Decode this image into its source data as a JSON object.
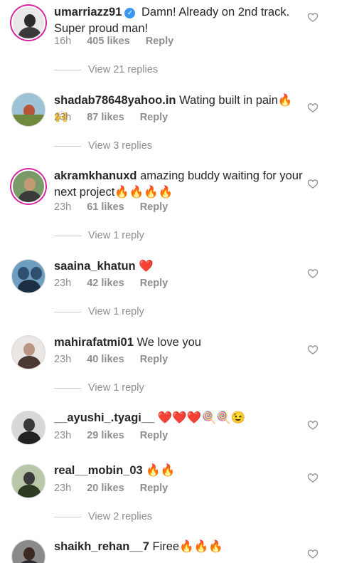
{
  "comments": [
    {
      "username": "umarriazz91",
      "verified": true,
      "text": "Damn! Already on 2nd track. Super proud man!",
      "time": "16h",
      "likes": "405 likes",
      "reply": "Reply",
      "view_replies": "View 21 replies",
      "avatar_colors": [
        "#e8e8e8",
        "#2b2b2b",
        "#3a3a3a"
      ]
    },
    {
      "username": "shadab78648yahoo.in",
      "verified": false,
      "text": "Wating built in pain🔥🙌",
      "time": "23h",
      "likes": "87 likes",
      "reply": "Reply",
      "view_replies": "View 3 replies",
      "avatar_colors": [
        "#9fc3d6",
        "#b7543a",
        "#6f8a3e"
      ]
    },
    {
      "username": "akramkhanuxd",
      "verified": false,
      "text": "amazing buddy waiting for your next project🔥🔥🔥🔥",
      "time": "23h",
      "likes": "61 likes",
      "reply": "Reply",
      "view_replies": "View 1 reply",
      "avatar_colors": [
        "#7a9a6a",
        "#c49a74",
        "#3a3a3a"
      ]
    },
    {
      "username": "saaina_khatun",
      "verified": false,
      "text": "❤️",
      "time": "23h",
      "likes": "42 likes",
      "reply": "Reply",
      "view_replies": "View 1 reply",
      "avatar_colors": [
        "#6f9fc0",
        "#2f4f6f",
        "#1d2f45"
      ]
    },
    {
      "username": "mahirafatmi01",
      "verified": false,
      "text": "We love you",
      "time": "23h",
      "likes": "40 likes",
      "reply": "Reply",
      "view_replies": "View 1 reply",
      "avatar_colors": [
        "#e9e6e4",
        "#b89683",
        "#4a3a32"
      ]
    },
    {
      "username": "__ayushi_.tyagi__",
      "verified": false,
      "text": "❤️❤️❤️🍭🍭😉",
      "time": "23h",
      "likes": "29 likes",
      "reply": "Reply",
      "view_replies": "",
      "avatar_colors": [
        "#d8d8d8",
        "#3a3a3a",
        "#222222"
      ]
    },
    {
      "username": "real__mobin_03",
      "verified": false,
      "text": "🔥🔥",
      "time": "23h",
      "likes": "20 likes",
      "reply": "Reply",
      "view_replies": "View 2 replies",
      "avatar_colors": [
        "#b9c7a8",
        "#3b3b3b",
        "#2d3a24"
      ]
    },
    {
      "username": "shaikh_rehan__7",
      "verified": false,
      "text": "Firee🔥🔥🔥",
      "time": "",
      "likes": "",
      "reply": "",
      "view_replies": "",
      "avatar_colors": [
        "#8a8a8a",
        "#3a2a22",
        "#2a2a2a"
      ]
    }
  ]
}
